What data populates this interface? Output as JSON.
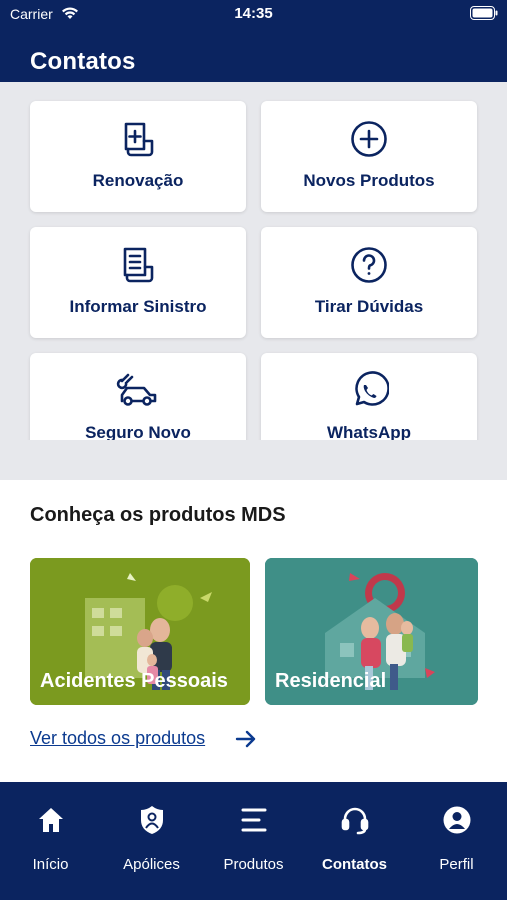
{
  "status": {
    "carrier": "Carrier",
    "time": "14:35"
  },
  "header": {
    "title": "Contatos"
  },
  "actions": [
    {
      "label": "Renovação",
      "icon": "document-plus-icon"
    },
    {
      "label": "Novos Produtos",
      "icon": "plus-circle-icon"
    },
    {
      "label": "Informar Sinistro",
      "icon": "document-lines-icon"
    },
    {
      "label": "Tirar Dúvidas",
      "icon": "question-circle-icon"
    },
    {
      "label": "Seguro Novo",
      "icon": "car-key-icon"
    },
    {
      "label": "WhatsApp",
      "icon": "whatsapp-icon"
    }
  ],
  "products": {
    "title": "Conheça os produtos MDS",
    "items": [
      {
        "label": "Acidentes Pessoais",
        "color": "#7b9a1f"
      },
      {
        "label": "Residencial",
        "color": "#3f8f87"
      }
    ],
    "see_all": "Ver todos os produtos"
  },
  "tabs": [
    {
      "label": "Início",
      "icon": "home-icon",
      "active": false
    },
    {
      "label": "Apólices",
      "icon": "shield-user-icon",
      "active": false
    },
    {
      "label": "Produtos",
      "icon": "menu-lines-icon",
      "active": false
    },
    {
      "label": "Contatos",
      "icon": "headset-icon",
      "active": true
    },
    {
      "label": "Perfil",
      "icon": "user-circle-icon",
      "active": false
    }
  ],
  "colors": {
    "brand": "#0b2460",
    "background": "#e7e8ec"
  }
}
